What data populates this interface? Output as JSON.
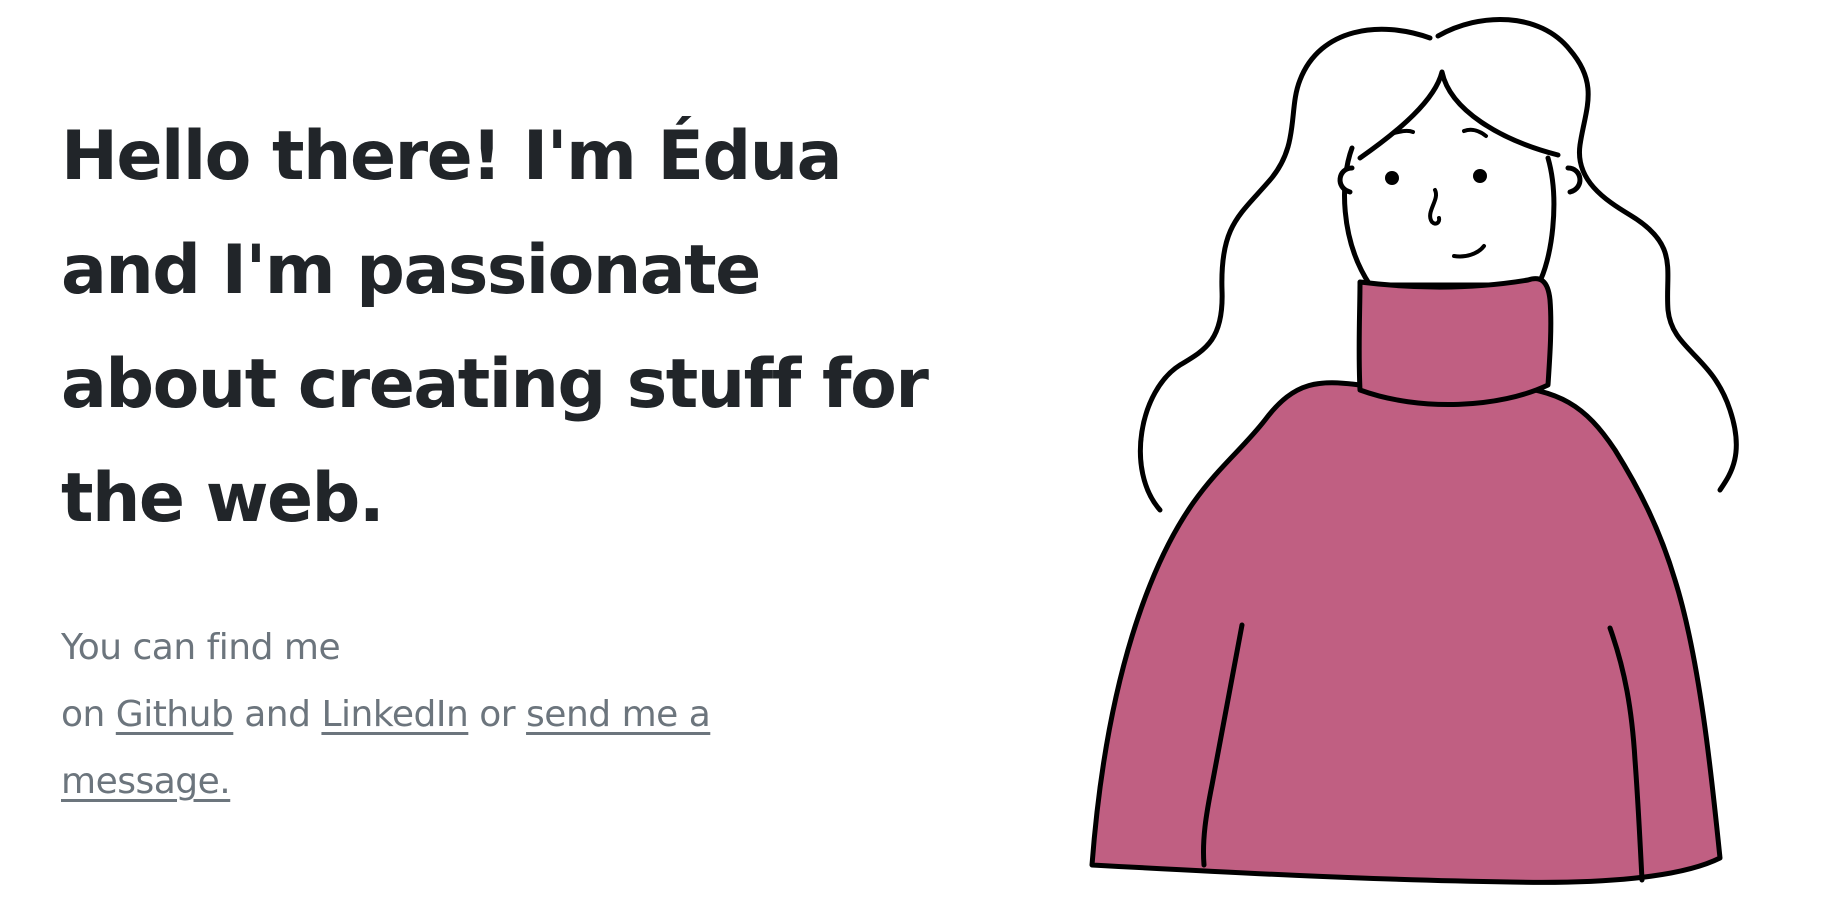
{
  "hero": {
    "headline_lines": [
      "Hello there! I'm Édua",
      "and I'm passionate",
      "about creating stuff for",
      "the web."
    ],
    "intro_line1": "You can find me",
    "intro_prefix": "on",
    "github_link": "Github",
    "and_text": "and",
    "linkedin_link": "LinkedIn",
    "or_text": "or",
    "message_link_part1": "send me a",
    "message_link_part2": "message."
  },
  "illustration": {
    "icon": "woman-in-turtleneck-illustration",
    "sweater_color": "#c05f82",
    "outline_color": "#000000"
  }
}
